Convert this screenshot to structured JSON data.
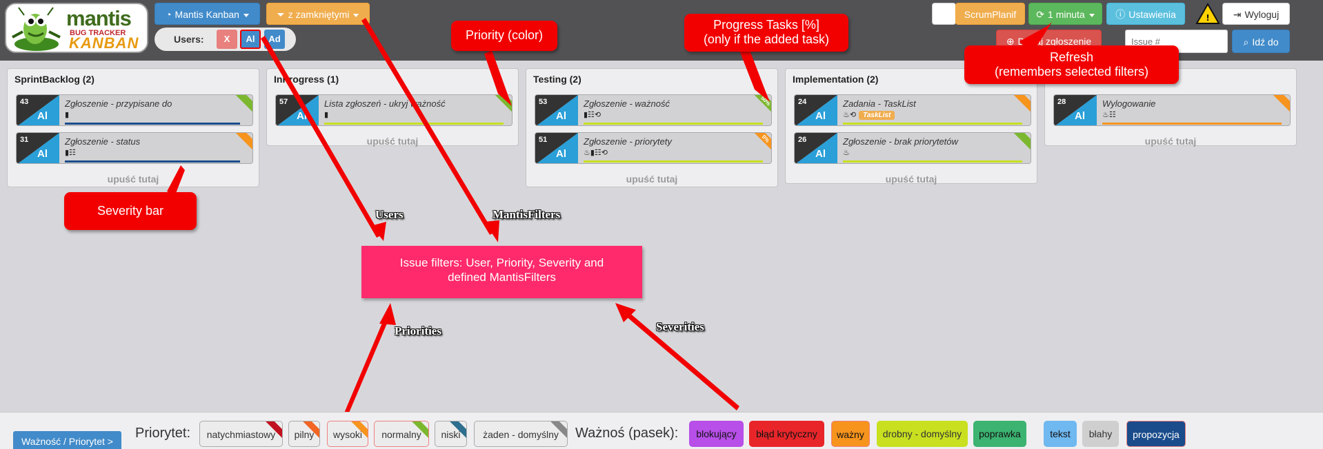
{
  "logo": {
    "line1": "mantis",
    "line2": "BUG TRACKER",
    "line3": "KANBAN"
  },
  "header": {
    "project": "Mantis Kanban",
    "filter": "z zamkniętymi",
    "users_label": "Users:",
    "user_buttons": [
      {
        "label": "X",
        "color": "#d9534f"
      },
      {
        "label": "Al",
        "color": "#428bca"
      },
      {
        "label": "Ad",
        "color": "#428bca"
      }
    ],
    "scrum": "ScrumPlanif",
    "refresh": "1 minuta",
    "settings": "Ustawienia",
    "logout": "Wyloguj",
    "add_issue": "Dodaj zgłoszenie",
    "issue_placeholder": "Issue #",
    "go_to": "Idź do"
  },
  "columns": [
    {
      "title": "SprintBacklog (2)",
      "drop": "upuść tutaj",
      "cards": [
        {
          "id": "43",
          "user": "Al",
          "title": "Zgłoszenie - przypisane do",
          "icons": "▮",
          "priority_color": "#7cb82f",
          "severity_color": "#1a4c8b"
        },
        {
          "id": "31",
          "user": "Al",
          "title": "Zgłoszenie - status",
          "icons": "▮☷",
          "priority_color": "#f7941d",
          "severity_color": "#1a4c8b"
        }
      ]
    },
    {
      "title": "InProgress (1)",
      "drop": "upuść tutaj",
      "cards": [
        {
          "id": "57",
          "user": "Al",
          "title": "Lista zgłoszeń - ukryj ważność",
          "icons": "▮",
          "priority_color": "#7cb82f",
          "severity_color": "#c8e020"
        }
      ]
    },
    {
      "title": "Testing (2)",
      "drop": "upuść tutaj",
      "cards": [
        {
          "id": "53",
          "user": "Al",
          "title": "Zgłoszenie - ważność",
          "icons": "▮☷⟲",
          "priority_color": "#7cb82f",
          "severity_color": "#c8e020",
          "progress": "50%"
        },
        {
          "id": "51",
          "user": "Al",
          "title": "Zgłoszenie - priorytety",
          "icons": "♨▮☷⟲",
          "priority_color": "#f7941d",
          "severity_color": "#c8e020",
          "progress": "0%"
        }
      ]
    },
    {
      "title": "Implementation (2)",
      "drop": "upuść tutaj",
      "cards": [
        {
          "id": "24",
          "user": "Al",
          "title": "Zadania - TaskList",
          "icons": "♨⟲",
          "tag": "TaskList",
          "priority_color": "#f7941d",
          "severity_color": "#c8e020"
        },
        {
          "id": "26",
          "user": "Al",
          "title": "Zgłoszenie - brak priorytetów",
          "icons": "♨",
          "priority_color": "#7cb82f",
          "severity_color": "#c8e020"
        }
      ]
    },
    {
      "title": "",
      "drop": "upuść tutaj",
      "cards": [
        {
          "id": "28",
          "user": "Al",
          "title": "Wylogowanie",
          "icons": "♨☷",
          "priority_color": "#f7941d",
          "severity_color": "#f7941d"
        }
      ]
    }
  ],
  "annotations": {
    "priority": "Priority (color)",
    "progress": [
      "Progress Tasks [%]",
      "(only if the added task)"
    ],
    "refresh": [
      "Refresh",
      "(remembers selected filters)"
    ],
    "severity_bar": "Severity bar",
    "issue_filters": [
      "Issue filters: User, Priority, Severity and",
      "defined MantisFilters"
    ],
    "users": "Users",
    "mantis_filters": "MantisFilters",
    "priorities": "Priorities",
    "severities": "Severities"
  },
  "footer": {
    "toggle": "Ważność / Priorytet  >",
    "priority_label": "Priorytet:",
    "priorities": [
      {
        "label": "natychmiastowy",
        "color": "#c1121f"
      },
      {
        "label": "pilny",
        "color": "#f26522"
      },
      {
        "label": "wysoki",
        "color": "#f7941d"
      },
      {
        "label": "normalny",
        "color": "#7cb82f"
      },
      {
        "label": "niski",
        "color": "#2e6e8e"
      },
      {
        "label": "żaden  - domyślny",
        "color": "#888888"
      }
    ],
    "severity_label": "Ważnoś (pasek):",
    "severities": [
      {
        "label": "blokujący",
        "bg": "#b74fe8",
        "fg": "#111"
      },
      {
        "label": "błąd krytyczny",
        "bg": "#e8262a",
        "fg": "#111"
      },
      {
        "label": "ważny",
        "bg": "#f7941d",
        "fg": "#111"
      },
      {
        "label": "drobny  - domyślny",
        "bg": "#c8e020",
        "fg": "#333"
      },
      {
        "label": "poprawka",
        "bg": "#3cb371",
        "fg": "#111"
      },
      {
        "label": "tekst",
        "bg": "#6fb8f0",
        "fg": "#111"
      },
      {
        "label": "błahy",
        "bg": "#cfcfcf",
        "fg": "#333"
      },
      {
        "label": "propozycja",
        "bg": "#1a4c8b",
        "fg": "#fff"
      }
    ]
  }
}
